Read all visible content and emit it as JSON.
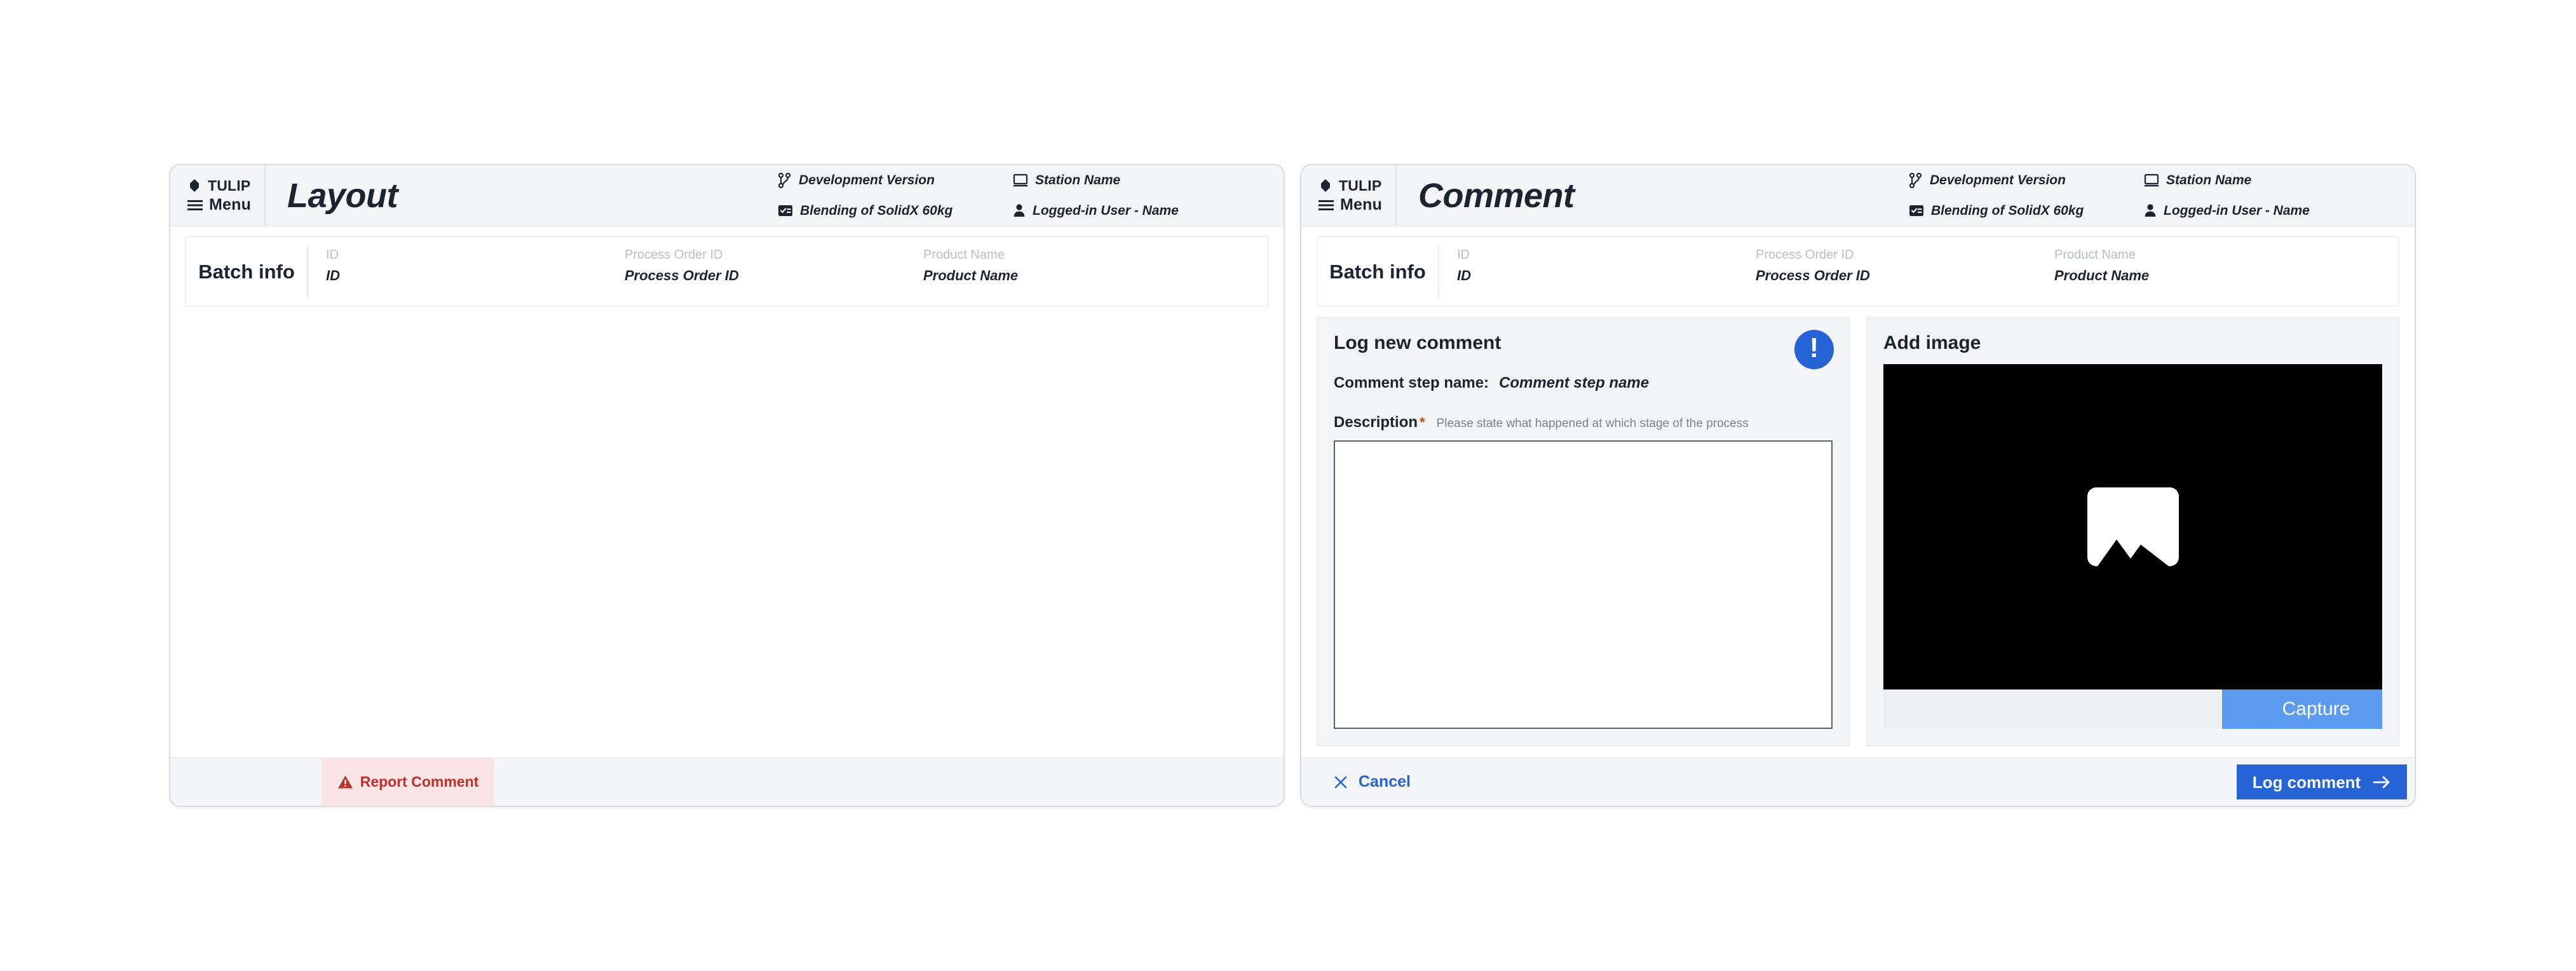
{
  "brand": {
    "name": "TULIP",
    "menu_label": "Menu",
    "logo_icon": "tulip-logo-icon",
    "menu_icon": "hamburger-menu-icon"
  },
  "panels": [
    {
      "id": "layout",
      "title": "Layout",
      "header_meta": [
        {
          "icon": "git-branch-icon",
          "label": "Development Version"
        },
        {
          "icon": "monitor-icon",
          "label": "Station Name"
        },
        {
          "icon": "task-list-icon",
          "label": "Blending of SolidX 60kg"
        },
        {
          "icon": "user-icon",
          "label": "Logged-in User - Name"
        }
      ],
      "batch_info": {
        "label": "Batch info",
        "fields": [
          {
            "header": "ID",
            "value": "ID"
          },
          {
            "header": "Process Order ID",
            "value": "Process Order ID"
          },
          {
            "header": "Product Name",
            "value": "Product Name"
          }
        ]
      },
      "footer": {
        "report_button": {
          "label": "Report Comment",
          "icon": "warning-triangle-icon",
          "bg_color": "#fbe4e4",
          "text_color": "#c0302b"
        }
      }
    },
    {
      "id": "comment",
      "title": "Comment",
      "header_meta": [
        {
          "icon": "git-branch-icon",
          "label": "Development Version"
        },
        {
          "icon": "monitor-icon",
          "label": "Station Name"
        },
        {
          "icon": "task-list-icon",
          "label": "Blending of SolidX 60kg"
        },
        {
          "icon": "user-icon",
          "label": "Logged-in User - Name"
        }
      ],
      "batch_info": {
        "label": "Batch info",
        "fields": [
          {
            "header": "ID",
            "value": "ID"
          },
          {
            "header": "Process Order ID",
            "value": "Process Order ID"
          },
          {
            "header": "Product Name",
            "value": "Product Name"
          }
        ]
      },
      "log_card": {
        "title": "Log new comment",
        "badge_icon": "alert-exclamation-icon",
        "badge_symbol": "!",
        "badge_color": "#2563d6",
        "step_label": "Comment step name:",
        "step_value": "Comment step name",
        "description_label": "Description",
        "required_mark": "*",
        "description_hint": "Please state what happened at which stage of the process",
        "description_value": "",
        "description_placeholder": ""
      },
      "image_card": {
        "title": "Add image",
        "placeholder_icon": "image-placeholder-icon",
        "capture_button": {
          "label": "Capture",
          "icon": "camera-aperture-icon",
          "bg_color": "#5b9bf0"
        }
      },
      "footer": {
        "cancel_button": {
          "label": "Cancel",
          "icon": "close-x-icon",
          "text_color": "#2563d6"
        },
        "submit_button": {
          "label": "Log comment",
          "icon": "arrow-right-icon",
          "bg_color": "#2563d6"
        }
      }
    }
  ]
}
